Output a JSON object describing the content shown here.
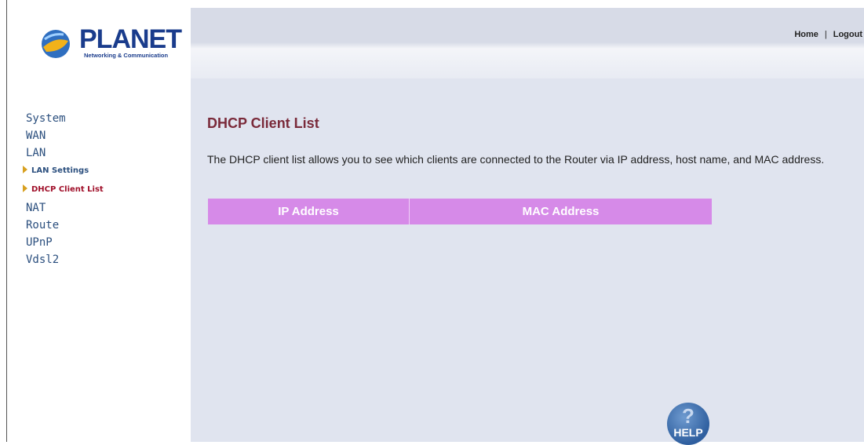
{
  "brand": {
    "name": "PLANET",
    "tagline": "Networking & Communication"
  },
  "topbar": {
    "home_label": "Home",
    "separator": "|",
    "logout_label": "Logout"
  },
  "sidebar": {
    "items": [
      {
        "label": "System"
      },
      {
        "label": "WAN"
      },
      {
        "label": "LAN"
      },
      {
        "label": "LAN Settings"
      },
      {
        "label": "DHCP Client List"
      },
      {
        "label": "NAT"
      },
      {
        "label": "Route"
      },
      {
        "label": "UPnP"
      },
      {
        "label": "Vdsl2"
      }
    ]
  },
  "main": {
    "title": "DHCP Client List",
    "description": "The DHCP client list allows you to see which clients are connected to the Router via IP address, host name, and MAC address.",
    "table": {
      "headers": [
        "IP Address",
        "MAC Address"
      ],
      "rows": []
    }
  },
  "help": {
    "glyph": "?",
    "label": "HELP"
  },
  "colors": {
    "table_header": "#d68ae8",
    "title": "#7a2a3a",
    "nav": "#2b4f7e",
    "nav_active": "#a0102a",
    "content_bg": "#e0e4ef"
  }
}
